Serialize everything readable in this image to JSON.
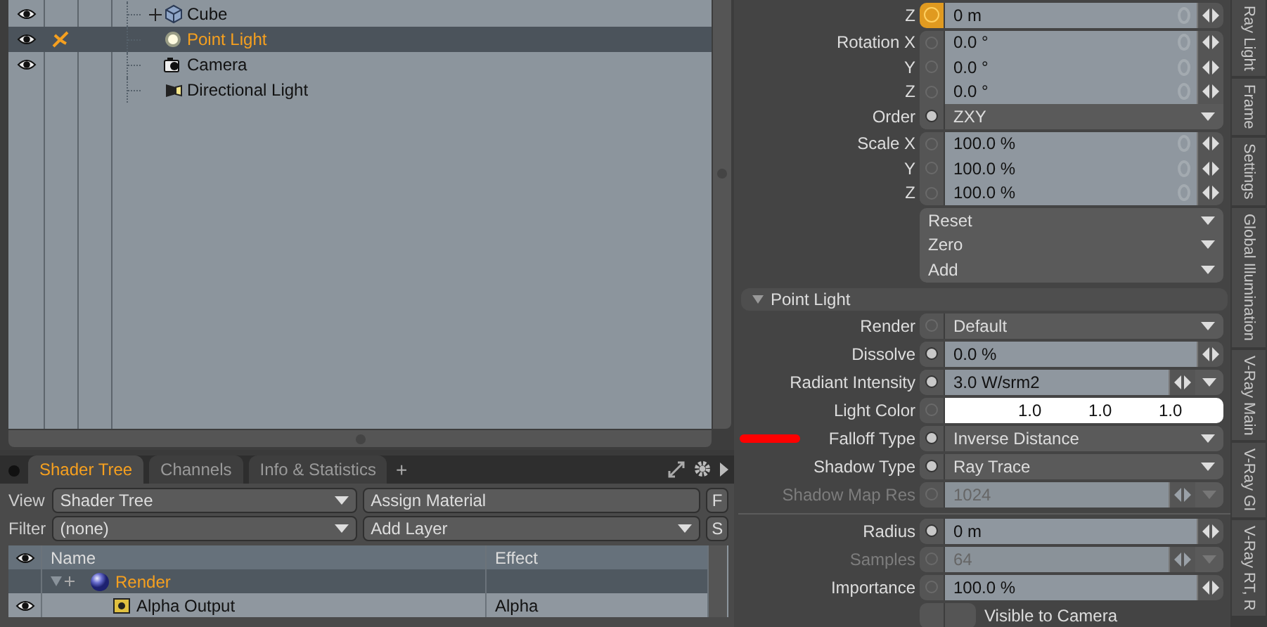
{
  "outliner": {
    "items": [
      {
        "label": "Cube",
        "kind": "cube",
        "visible": true,
        "current": false,
        "selected": false,
        "expanded": false
      },
      {
        "label": "Point Light",
        "kind": "point_light",
        "visible": true,
        "current": true,
        "selected": true
      },
      {
        "label": "Camera",
        "kind": "camera",
        "visible": true,
        "current": false,
        "selected": false
      },
      {
        "label": "Directional Light",
        "kind": "directional_light",
        "visible": false,
        "current": false,
        "selected": false
      }
    ]
  },
  "shader_panel": {
    "tabs": [
      {
        "label": "Shader Tree",
        "selected": true
      },
      {
        "label": "Channels",
        "selected": false
      },
      {
        "label": "Info & Statistics",
        "selected": false
      }
    ],
    "add_tab": "+",
    "view": {
      "label": "View",
      "value": "Shader Tree"
    },
    "assign_button": "Assign Material",
    "f_button": "F",
    "filter": {
      "label": "Filter",
      "value": "(none)"
    },
    "add_layer": "Add Layer",
    "s_button": "S",
    "columns": [
      "Name",
      "Effect"
    ],
    "rows": [
      {
        "name": "Render",
        "kind": "render",
        "visible": false,
        "selected": true,
        "expanded": true,
        "children": [
          {
            "name": "Alpha Output",
            "effect": "Alpha",
            "kind": "output",
            "visible": true,
            "selected": false
          }
        ]
      }
    ]
  },
  "properties": {
    "blocks": [
      {
        "kind": "group",
        "rows": [
          {
            "kind": "field",
            "label": "Z",
            "value": "0 m",
            "keyed": true,
            "animated": false,
            "ghost": true,
            "menu": false,
            "disabled": false
          }
        ]
      },
      {
        "kind": "group",
        "rows": [
          {
            "kind": "field",
            "label": "Rotation X",
            "value": "0.0 °",
            "keyed": false,
            "animated": false,
            "ghost": true,
            "menu": false,
            "disabled": false
          },
          {
            "kind": "field",
            "label": "Y",
            "value": "0.0 °",
            "keyed": false,
            "animated": false,
            "ghost": true,
            "menu": false,
            "disabled": false
          },
          {
            "kind": "field",
            "label": "Z",
            "value": "0.0 °",
            "keyed": false,
            "animated": false,
            "ghost": true,
            "menu": false,
            "disabled": false
          },
          {
            "kind": "dropdown",
            "label": "Order",
            "value": "ZXY",
            "keyed": false,
            "animated": true,
            "annotated": false
          }
        ]
      },
      {
        "kind": "group",
        "rows": [
          {
            "kind": "field",
            "label": "Scale X",
            "value": "100.0 %",
            "keyed": false,
            "animated": false,
            "ghost": true,
            "menu": false,
            "disabled": false
          },
          {
            "kind": "field",
            "label": "Y",
            "value": "100.0 %",
            "keyed": false,
            "animated": false,
            "ghost": true,
            "menu": false,
            "disabled": false
          },
          {
            "kind": "field",
            "label": "Z",
            "value": "100.0 %",
            "keyed": false,
            "animated": false,
            "ghost": true,
            "menu": false,
            "disabled": false
          }
        ]
      },
      {
        "kind": "group",
        "rows": [
          {
            "kind": "action",
            "value": "Reset"
          },
          {
            "kind": "action",
            "value": "Zero"
          },
          {
            "kind": "action",
            "value": "Add"
          }
        ]
      },
      {
        "kind": "header",
        "label": "Point Light",
        "expanded": true
      },
      {
        "kind": "group",
        "rows": [
          {
            "kind": "dropdown",
            "label": "Render",
            "value": "Default",
            "keyed": false,
            "animated": false,
            "annotated": false
          }
        ]
      },
      {
        "kind": "group",
        "rows": [
          {
            "kind": "field",
            "label": "Dissolve",
            "value": "0.0 %",
            "keyed": false,
            "animated": true,
            "ghost": false,
            "menu": false,
            "disabled": false
          }
        ]
      },
      {
        "kind": "group",
        "rows": [
          {
            "kind": "field",
            "label": "Radiant Intensity",
            "value": "3.0 W/srm2",
            "keyed": false,
            "animated": true,
            "ghost": false,
            "menu": true,
            "disabled": false
          }
        ]
      },
      {
        "kind": "group",
        "rows": [
          {
            "kind": "color",
            "label": "Light Color",
            "values": [
              "1.0",
              "1.0",
              "1.0"
            ],
            "keyed": false,
            "animated": false
          }
        ]
      },
      {
        "kind": "group",
        "rows": [
          {
            "kind": "dropdown",
            "label": "Falloff Type",
            "value": "Inverse Distance",
            "keyed": false,
            "animated": true,
            "annotated": true
          }
        ]
      },
      {
        "kind": "group",
        "rows": [
          {
            "kind": "dropdown",
            "label": "Shadow Type",
            "value": "Ray Trace",
            "keyed": false,
            "animated": true,
            "annotated": false
          }
        ]
      },
      {
        "kind": "group",
        "rows": [
          {
            "kind": "field",
            "label": "Shadow Map Res",
            "value": "1024",
            "keyed": false,
            "animated": false,
            "ghost": false,
            "menu": true,
            "disabled": true
          }
        ]
      },
      {
        "kind": "divider"
      },
      {
        "kind": "group",
        "rows": [
          {
            "kind": "field",
            "label": "Radius",
            "value": "0 m",
            "keyed": false,
            "animated": true,
            "ghost": false,
            "menu": false,
            "disabled": false
          }
        ]
      },
      {
        "kind": "group",
        "rows": [
          {
            "kind": "field",
            "label": "Samples",
            "value": "64",
            "keyed": false,
            "animated": false,
            "ghost": false,
            "menu": true,
            "disabled": true
          }
        ]
      },
      {
        "kind": "group",
        "rows": [
          {
            "kind": "field",
            "label": "Importance",
            "value": "100.0 %",
            "keyed": false,
            "animated": false,
            "ghost": false,
            "menu": false,
            "disabled": false
          }
        ]
      },
      {
        "kind": "group",
        "rows": [
          {
            "kind": "checkbox",
            "label": "Visible to Camera",
            "checked": false
          }
        ]
      }
    ]
  },
  "side_tabs": [
    {
      "label": "Ray Light",
      "selected": false
    },
    {
      "label": "Frame",
      "selected": false
    },
    {
      "label": "Settings",
      "selected": false
    },
    {
      "label": "Global Illumination",
      "selected": false
    },
    {
      "label": "V-Ray Main",
      "selected": false
    },
    {
      "label": "V-Ray GI",
      "selected": false
    },
    {
      "label": "V-Ray RT, R",
      "selected": false
    }
  ]
}
